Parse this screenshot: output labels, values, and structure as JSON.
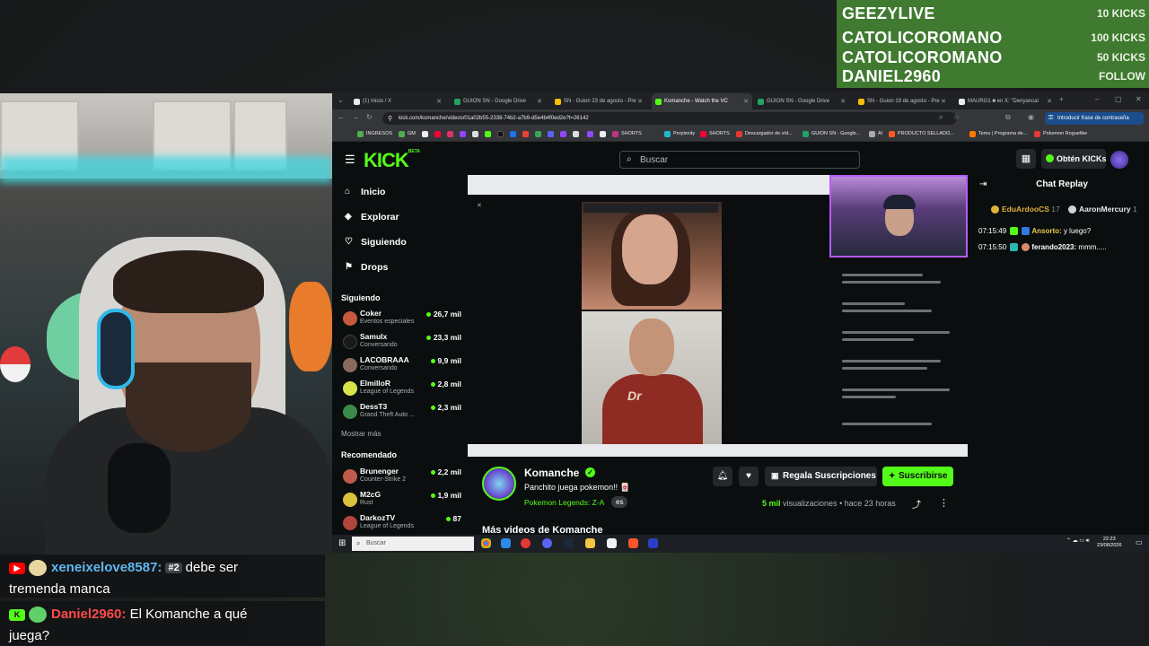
{
  "kicks_overlay": [
    {
      "name": "GEEZYLIVE",
      "amount": "10 KICKS"
    },
    {
      "name": "CATOLICOROMANO",
      "amount": "100 KICKS"
    },
    {
      "name": "CATOLICOROMANO",
      "amount": "50 KICKS"
    },
    {
      "name": "DANIEL2960",
      "amount": "FOLLOW"
    }
  ],
  "browser": {
    "tabs": [
      {
        "label": "(1) Inicio / X",
        "color": "#e8eaed"
      },
      {
        "label": "GUION SN - Google Drive",
        "color": "#1fa463"
      },
      {
        "label": "SN - Guion 23 de agosto - Pre",
        "color": "#fbbc04"
      },
      {
        "label": "Komanche - Watch the VC",
        "color": "#53fc18"
      },
      {
        "label": "GUION SN - Google Drive",
        "color": "#1fa463"
      },
      {
        "label": "SN - Guion 19 de agosto - Pre",
        "color": "#fbbc04"
      },
      {
        "label": "MAURG1 ■ en X: \"Denyancal",
        "color": "#e8eaed"
      }
    ],
    "url": "kick.com/komanche/videos/01a02b55-2338-74b2-a7b9-d5e4b4f0ed2e?t=26142",
    "password_button": "Introducir frase de contraseña",
    "bookmarks": [
      "INGRESOS",
      "GM",
      "SHORTS",
      "Perplexity",
      "SHORTS",
      "Descargador de víd...",
      "GUION SN - Google...",
      "AI",
      "PRODUCTO SELLADO...",
      "Temu | Programa de...",
      "Pokemon Roguelike"
    ]
  },
  "kick": {
    "logo": "KICK",
    "logo_sup": "BETA",
    "search_placeholder": "Buscar",
    "get_kicks": "Obtén KICKs",
    "nav": [
      {
        "label": "Inicio",
        "icon": "home-icon"
      },
      {
        "label": "Explorar",
        "icon": "compass-icon"
      },
      {
        "label": "Siguiendo",
        "icon": "heart-icon"
      },
      {
        "label": "Drops",
        "icon": "gift-icon"
      }
    ],
    "following_header": "Siguiendo",
    "following": [
      {
        "name": "Coker",
        "category": "Eventos especiales",
        "viewers": "26,7 mil",
        "color": "#c45a3a"
      },
      {
        "name": "Samulx",
        "category": "Conversando",
        "viewers": "23,3 mil",
        "color": "#1a1a1a"
      },
      {
        "name": "LACOBRAAA",
        "category": "Conversando",
        "viewers": "9,9 mil",
        "color": "#8a6a5a"
      },
      {
        "name": "ElmilloR",
        "category": "League of Legends",
        "viewers": "2,8 mil",
        "color": "#d7e34a"
      },
      {
        "name": "DessT3",
        "category": "Grand Theft Auto ...",
        "viewers": "2,3 mil",
        "color": "#3c8a4a"
      }
    ],
    "show_more": "Mostrar más",
    "recommended_header": "Recomendado",
    "recommended": [
      {
        "name": "Brunenger",
        "category": "Counter-Strike 2",
        "viewers": "2,2 mil",
        "color": "#c05a4a"
      },
      {
        "name": "M2cG",
        "category": "Rust",
        "viewers": "1,9 mil",
        "color": "#d9c33a"
      },
      {
        "name": "DarkozTV",
        "category": "League of Legends",
        "viewers": "87",
        "color": "#b0453a"
      }
    ],
    "channel": {
      "name": "Komanche",
      "title": "Panchito juega pokemon!! 🀄",
      "category": "Pokemon Legends: Z-A",
      "language": "es",
      "gift_label": "Regala Suscripciones",
      "subscribe_label": "Suscribirse",
      "views_count": "5 mil",
      "views_label": "visualizaciones",
      "time_ago": "hace 23 horas",
      "more_videos": "Más videos de Komanche"
    },
    "chat": {
      "title": "Chat Replay",
      "pinned": [
        {
          "name": "EduArdooCS",
          "count": "17",
          "color": "#e0b13a"
        },
        {
          "name": "AaronMercury",
          "count": "1",
          "color": "#cfd3d6"
        }
      ],
      "messages": [
        {
          "time": "07:15:49",
          "user": "Ansorto:",
          "text": "y luego?",
          "user_color": "#e6c84a"
        },
        {
          "time": "07:15:50",
          "user": "ferando2023:",
          "text": "mmm.....",
          "user_color": "#ffffff"
        }
      ]
    }
  },
  "taskbar": {
    "search_placeholder": "Buscar",
    "time": "22:23",
    "date": "23/08/2026"
  },
  "overlay_chat": [
    {
      "platform": "youtube",
      "user": "xeneixelove8587:",
      "rank": "#2",
      "text_line1": "debe ser",
      "text_line2": "tremenda manca",
      "user_color": "#5fb8f0"
    },
    {
      "platform": "kick",
      "user": "Daniel2960:",
      "text_line1": "El Komanche a qué",
      "text_line2": "juega?",
      "user_color": "#ff4a4a"
    }
  ]
}
